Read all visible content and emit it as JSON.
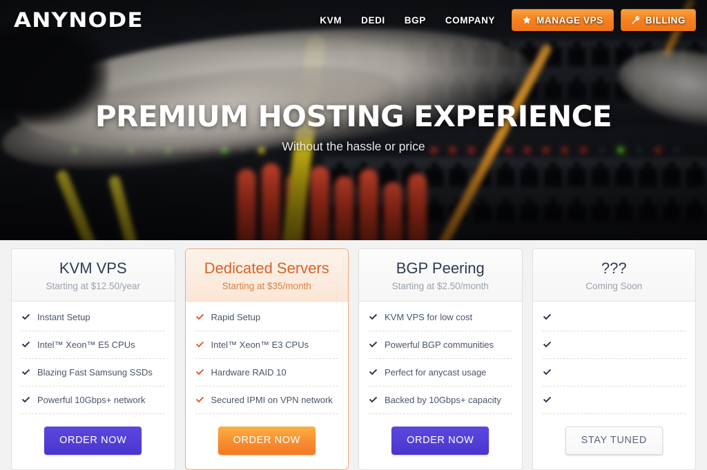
{
  "brand": {
    "logo_text": "ANYNODE",
    "accent_orange": "#f58220",
    "accent_purple": "#5340d6",
    "featured_border": "#f0a878",
    "title_navy": "#2f3b52"
  },
  "nav": {
    "links": [
      {
        "label": "KVM"
      },
      {
        "label": "DEDI"
      },
      {
        "label": "BGP"
      },
      {
        "label": "COMPANY"
      }
    ],
    "buttons": [
      {
        "label": "MANAGE VPS",
        "icon": "star-icon"
      },
      {
        "label": "BILLING",
        "icon": "key-icon"
      }
    ]
  },
  "hero": {
    "heading": "PREMIUM HOSTING EXPERIENCE",
    "subheading": "Without the hassle or price"
  },
  "pricing": {
    "cards": [
      {
        "title": "KVM VPS",
        "subtitle": "Starting at $12.50/year",
        "featured": false,
        "features": [
          "Instant Setup",
          "Intel™ Xeon™ E5 CPUs",
          "Blazing Fast Samsung SSDs",
          "Powerful 10Gbps+ network"
        ],
        "cta": "ORDER NOW",
        "cta_style": "purple"
      },
      {
        "title": "Dedicated Servers",
        "subtitle": "Starting at $35/month",
        "featured": true,
        "features": [
          "Rapid Setup",
          "Intel™ Xeon™ E3 CPUs",
          "Hardware RAID 10",
          "Secured IPMI on VPN network"
        ],
        "cta": "ORDER NOW",
        "cta_style": "orange"
      },
      {
        "title": "BGP Peering",
        "subtitle": "Starting at $2.50/month",
        "featured": false,
        "features": [
          "KVM VPS for low cost",
          "Powerful BGP communities",
          "Perfect for anycast usage",
          "Backed by 10Gbps+ capacity"
        ],
        "cta": "ORDER NOW",
        "cta_style": "purple"
      },
      {
        "title": "???",
        "subtitle": "Coming Soon",
        "featured": false,
        "features": [
          "",
          "",
          "",
          ""
        ],
        "cta": "STAY TUNED",
        "cta_style": "ghost"
      }
    ]
  }
}
